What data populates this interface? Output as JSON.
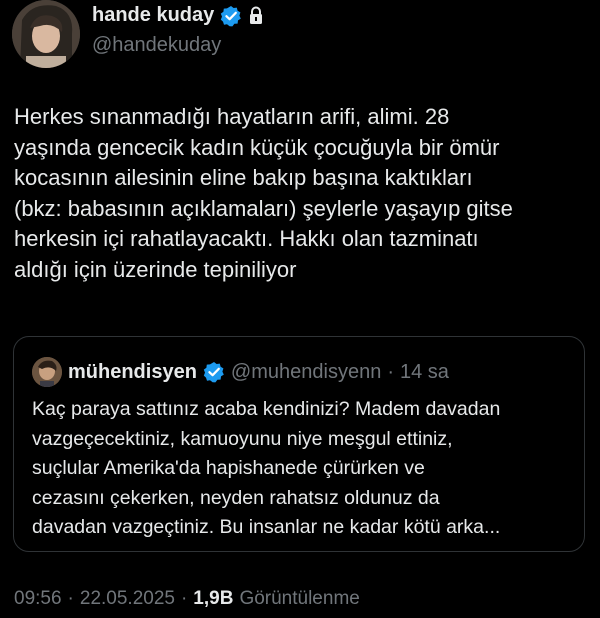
{
  "author": {
    "display_name": "hande kuday",
    "handle": "@handekuday"
  },
  "tweet": {
    "lines": [
      "Herkes sınanmadığı hayatların arifi, alimi. 28",
      "yaşında gencecik kadın küçük çocuğuyla bir ömür",
      "kocasının ailesinin eline bakıp başına kaktıkları",
      "(bkz: babasının açıklamaları) şeylerle yaşayıp gitse",
      "herkesin içi rahatlayacaktı. Hakkı olan tazminatı",
      "aldığı için üzerinde tepiniliyor"
    ]
  },
  "quote": {
    "display_name": "mühendisyen",
    "handle": "@muhendisyenn",
    "separator": "·",
    "time": "14 sa",
    "lines": [
      "Kaç paraya sattınız acaba kendinizi? Madem davadan",
      "vazgeçecektiniz, kamuoyunu niye meşgul ettiniz,",
      "suçlular Amerika'da hapishanede çürürken ve",
      "cezasını çekerken, neyden rahatsız oldunuz da",
      "davadan vazgeçtiniz. Bu insanlar ne kadar kötü arka..."
    ]
  },
  "meta": {
    "time": "09:56",
    "separator1": "·",
    "date": "22.05.2025",
    "separator2": "·",
    "views_count": "1,9B",
    "views_label": "Görüntülenme"
  },
  "colors": {
    "background": "#000000",
    "text": "#e7e9ea",
    "secondary": "#71767b",
    "verified": "#1d9bf0",
    "border": "#2f3336"
  },
  "icons": [
    "verified-badge-icon",
    "lock-icon"
  ]
}
